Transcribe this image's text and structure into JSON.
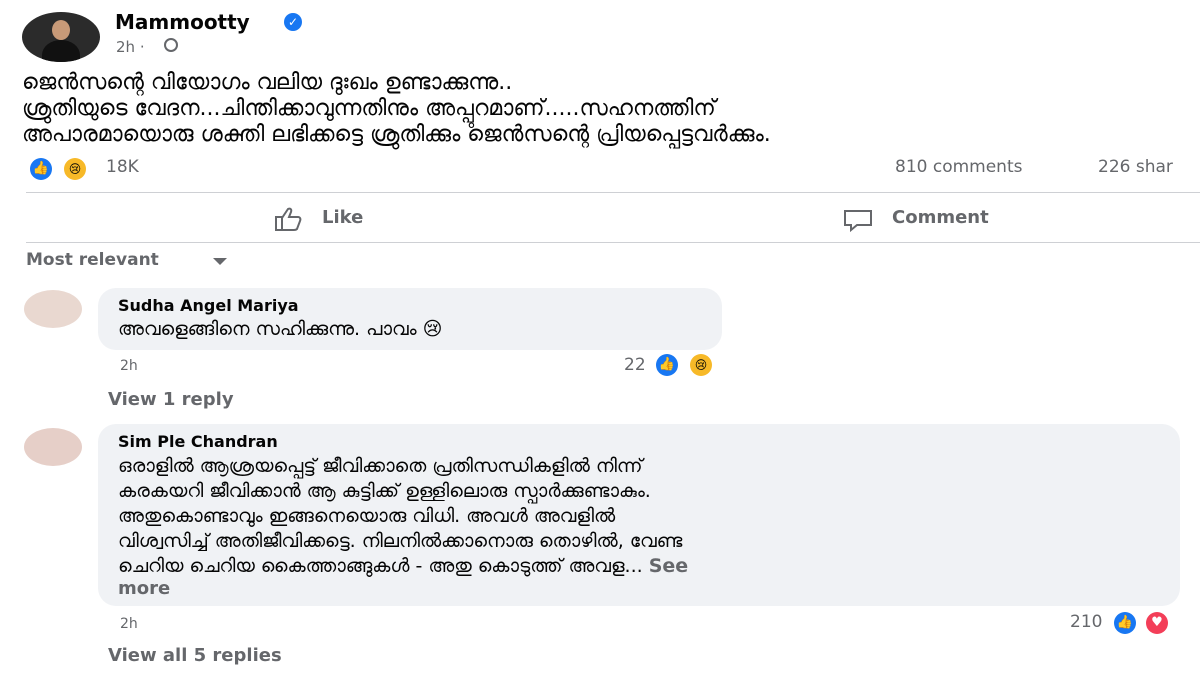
{
  "post": {
    "author": "Mammootty",
    "time": "2h",
    "text_lines": [
      "ജെൻസന്റെ വിയോഗം വലിയ ദുഃഖം ഉണ്ടാക്കുന്നു..",
      "ശ്രുതിയുടെ വേദന...ചിന്തിക്കാവുന്നതിനും അപ്പുറമാണ്.....സഹനത്തിന്",
      "അപാരമായൊരു ശക്തി ലഭിക്കട്ടെ ശ്രുതിക്കും ജെൻസന്റെ പ്രിയപ്പെട്ടവർക്കും."
    ],
    "reaction_count": "18K",
    "comments_count": "810 comments",
    "shares_count": "226 shar"
  },
  "actions": {
    "like": "Like",
    "comment": "Comment"
  },
  "sort_label": "Most relevant",
  "comments": [
    {
      "author": "Sudha Angel Mariya",
      "text_lines": [
        "അവളെങ്ങിനെ സഹിക്കുന്നു. പാവം 😢"
      ],
      "time": "2h",
      "reaction_count": "22",
      "replies_link": "View 1 reply"
    },
    {
      "author": "Sim Ple Chandran",
      "text_lines": [
        "ഒരാളിൽ ആശ്രയപ്പെട്ട് ജീവിക്കാതെ പ്രതിസന്ധികളിൽ നിന്ന്",
        "കരകയറി ജീവിക്കാൻ ആ കുട്ടിക്ക് ഉള്ളിലൊരു സ്പാർക്കുണ്ടാകും.",
        "അതുകൊണ്ടാവും ഇങ്ങനെയൊരു വിധി. അവൾ അവളിൽ",
        "വിശ്വസിച്ച് അതിജീവിക്കട്ടെ. നിലനിൽക്കാനൊരു തൊഴിൽ, വേണ്ട",
        "ചെറിയ ചെറിയ കൈത്താങ്ങുകൾ - അതു കൊടുത്ത് അവള...",
        "more"
      ],
      "see_more": "See",
      "time": "2h",
      "reaction_count": "210",
      "replies_link": "View all 5 replies"
    }
  ],
  "colors": {
    "accent": "#1877f2",
    "muted": "#65676b",
    "bubble": "#f0f2f5",
    "sad": "#f7b928",
    "love": "#f33e58"
  }
}
